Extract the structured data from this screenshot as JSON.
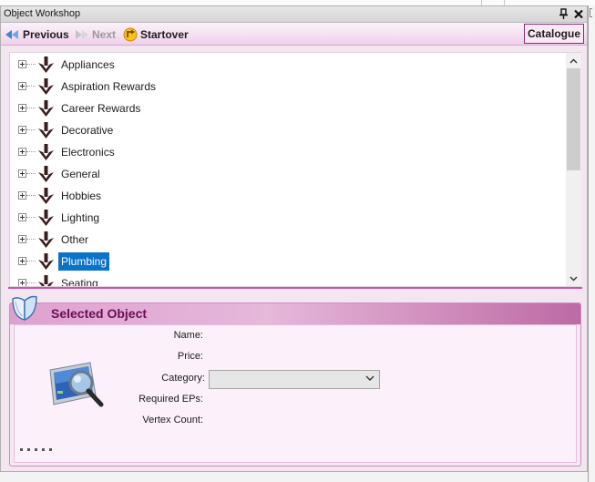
{
  "window": {
    "title": "Object Workshop"
  },
  "toolbar": {
    "previous_label": "Previous",
    "next_label": "Next",
    "startover_label": "Startover",
    "catalogue_label": "Catalogue"
  },
  "tree": {
    "items": [
      {
        "label": "Appliances",
        "selected": false
      },
      {
        "label": "Aspiration Rewards",
        "selected": false
      },
      {
        "label": "Career Rewards",
        "selected": false
      },
      {
        "label": "Decorative",
        "selected": false
      },
      {
        "label": "Electronics",
        "selected": false
      },
      {
        "label": "General",
        "selected": false
      },
      {
        "label": "Hobbies",
        "selected": false
      },
      {
        "label": "Lighting",
        "selected": false
      },
      {
        "label": "Other",
        "selected": false
      },
      {
        "label": "Plumbing",
        "selected": true
      },
      {
        "label": "Seating",
        "selected": false
      }
    ],
    "item_icon": "arrow-down-icon",
    "expander_icon": "plus-box-icon"
  },
  "selected_object": {
    "title": "Selected Object",
    "fields": {
      "name_label": "Name:",
      "price_label": "Price:",
      "category_label": "Category:",
      "required_eps_label": "Required EPs:",
      "vertex_count_label": "Vertex Count:"
    },
    "category_value": "",
    "image_icon": "magnifier-on-screen-icon",
    "header_icon": "open-book-icon"
  },
  "colors": {
    "selection": "#0a72c7",
    "accent": "#6b0d56",
    "panel_background": "#f3e6f1"
  }
}
